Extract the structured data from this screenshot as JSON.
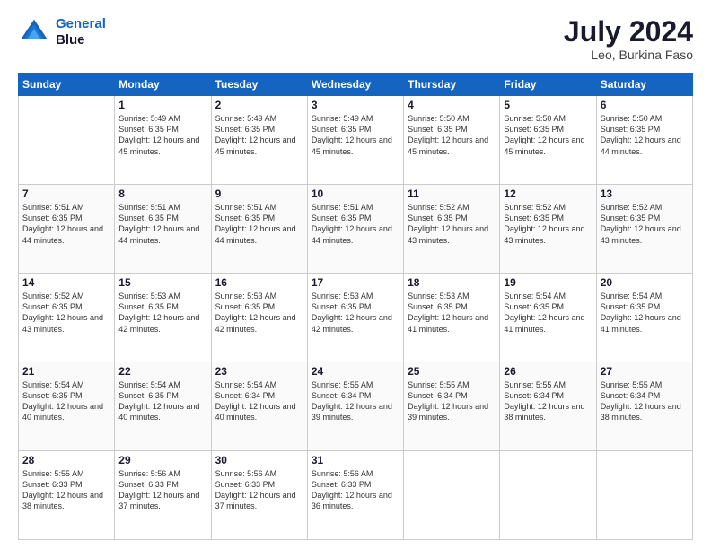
{
  "header": {
    "logo_line1": "General",
    "logo_line2": "Blue",
    "main_title": "July 2024",
    "subtitle": "Leo, Burkina Faso"
  },
  "weekdays": [
    "Sunday",
    "Monday",
    "Tuesday",
    "Wednesday",
    "Thursday",
    "Friday",
    "Saturday"
  ],
  "weeks": [
    [
      {
        "day": "",
        "sunrise": "",
        "sunset": "",
        "daylight": ""
      },
      {
        "day": "1",
        "sunrise": "Sunrise: 5:49 AM",
        "sunset": "Sunset: 6:35 PM",
        "daylight": "Daylight: 12 hours and 45 minutes."
      },
      {
        "day": "2",
        "sunrise": "Sunrise: 5:49 AM",
        "sunset": "Sunset: 6:35 PM",
        "daylight": "Daylight: 12 hours and 45 minutes."
      },
      {
        "day": "3",
        "sunrise": "Sunrise: 5:49 AM",
        "sunset": "Sunset: 6:35 PM",
        "daylight": "Daylight: 12 hours and 45 minutes."
      },
      {
        "day": "4",
        "sunrise": "Sunrise: 5:50 AM",
        "sunset": "Sunset: 6:35 PM",
        "daylight": "Daylight: 12 hours and 45 minutes."
      },
      {
        "day": "5",
        "sunrise": "Sunrise: 5:50 AM",
        "sunset": "Sunset: 6:35 PM",
        "daylight": "Daylight: 12 hours and 45 minutes."
      },
      {
        "day": "6",
        "sunrise": "Sunrise: 5:50 AM",
        "sunset": "Sunset: 6:35 PM",
        "daylight": "Daylight: 12 hours and 44 minutes."
      }
    ],
    [
      {
        "day": "7",
        "sunrise": "Sunrise: 5:51 AM",
        "sunset": "Sunset: 6:35 PM",
        "daylight": "Daylight: 12 hours and 44 minutes."
      },
      {
        "day": "8",
        "sunrise": "Sunrise: 5:51 AM",
        "sunset": "Sunset: 6:35 PM",
        "daylight": "Daylight: 12 hours and 44 minutes."
      },
      {
        "day": "9",
        "sunrise": "Sunrise: 5:51 AM",
        "sunset": "Sunset: 6:35 PM",
        "daylight": "Daylight: 12 hours and 44 minutes."
      },
      {
        "day": "10",
        "sunrise": "Sunrise: 5:51 AM",
        "sunset": "Sunset: 6:35 PM",
        "daylight": "Daylight: 12 hours and 44 minutes."
      },
      {
        "day": "11",
        "sunrise": "Sunrise: 5:52 AM",
        "sunset": "Sunset: 6:35 PM",
        "daylight": "Daylight: 12 hours and 43 minutes."
      },
      {
        "day": "12",
        "sunrise": "Sunrise: 5:52 AM",
        "sunset": "Sunset: 6:35 PM",
        "daylight": "Daylight: 12 hours and 43 minutes."
      },
      {
        "day": "13",
        "sunrise": "Sunrise: 5:52 AM",
        "sunset": "Sunset: 6:35 PM",
        "daylight": "Daylight: 12 hours and 43 minutes."
      }
    ],
    [
      {
        "day": "14",
        "sunrise": "Sunrise: 5:52 AM",
        "sunset": "Sunset: 6:35 PM",
        "daylight": "Daylight: 12 hours and 43 minutes."
      },
      {
        "day": "15",
        "sunrise": "Sunrise: 5:53 AM",
        "sunset": "Sunset: 6:35 PM",
        "daylight": "Daylight: 12 hours and 42 minutes."
      },
      {
        "day": "16",
        "sunrise": "Sunrise: 5:53 AM",
        "sunset": "Sunset: 6:35 PM",
        "daylight": "Daylight: 12 hours and 42 minutes."
      },
      {
        "day": "17",
        "sunrise": "Sunrise: 5:53 AM",
        "sunset": "Sunset: 6:35 PM",
        "daylight": "Daylight: 12 hours and 42 minutes."
      },
      {
        "day": "18",
        "sunrise": "Sunrise: 5:53 AM",
        "sunset": "Sunset: 6:35 PM",
        "daylight": "Daylight: 12 hours and 41 minutes."
      },
      {
        "day": "19",
        "sunrise": "Sunrise: 5:54 AM",
        "sunset": "Sunset: 6:35 PM",
        "daylight": "Daylight: 12 hours and 41 minutes."
      },
      {
        "day": "20",
        "sunrise": "Sunrise: 5:54 AM",
        "sunset": "Sunset: 6:35 PM",
        "daylight": "Daylight: 12 hours and 41 minutes."
      }
    ],
    [
      {
        "day": "21",
        "sunrise": "Sunrise: 5:54 AM",
        "sunset": "Sunset: 6:35 PM",
        "daylight": "Daylight: 12 hours and 40 minutes."
      },
      {
        "day": "22",
        "sunrise": "Sunrise: 5:54 AM",
        "sunset": "Sunset: 6:35 PM",
        "daylight": "Daylight: 12 hours and 40 minutes."
      },
      {
        "day": "23",
        "sunrise": "Sunrise: 5:54 AM",
        "sunset": "Sunset: 6:34 PM",
        "daylight": "Daylight: 12 hours and 40 minutes."
      },
      {
        "day": "24",
        "sunrise": "Sunrise: 5:55 AM",
        "sunset": "Sunset: 6:34 PM",
        "daylight": "Daylight: 12 hours and 39 minutes."
      },
      {
        "day": "25",
        "sunrise": "Sunrise: 5:55 AM",
        "sunset": "Sunset: 6:34 PM",
        "daylight": "Daylight: 12 hours and 39 minutes."
      },
      {
        "day": "26",
        "sunrise": "Sunrise: 5:55 AM",
        "sunset": "Sunset: 6:34 PM",
        "daylight": "Daylight: 12 hours and 38 minutes."
      },
      {
        "day": "27",
        "sunrise": "Sunrise: 5:55 AM",
        "sunset": "Sunset: 6:34 PM",
        "daylight": "Daylight: 12 hours and 38 minutes."
      }
    ],
    [
      {
        "day": "28",
        "sunrise": "Sunrise: 5:55 AM",
        "sunset": "Sunset: 6:33 PM",
        "daylight": "Daylight: 12 hours and 38 minutes."
      },
      {
        "day": "29",
        "sunrise": "Sunrise: 5:56 AM",
        "sunset": "Sunset: 6:33 PM",
        "daylight": "Daylight: 12 hours and 37 minutes."
      },
      {
        "day": "30",
        "sunrise": "Sunrise: 5:56 AM",
        "sunset": "Sunset: 6:33 PM",
        "daylight": "Daylight: 12 hours and 37 minutes."
      },
      {
        "day": "31",
        "sunrise": "Sunrise: 5:56 AM",
        "sunset": "Sunset: 6:33 PM",
        "daylight": "Daylight: 12 hours and 36 minutes."
      },
      {
        "day": "",
        "sunrise": "",
        "sunset": "",
        "daylight": ""
      },
      {
        "day": "",
        "sunrise": "",
        "sunset": "",
        "daylight": ""
      },
      {
        "day": "",
        "sunrise": "",
        "sunset": "",
        "daylight": ""
      }
    ]
  ]
}
